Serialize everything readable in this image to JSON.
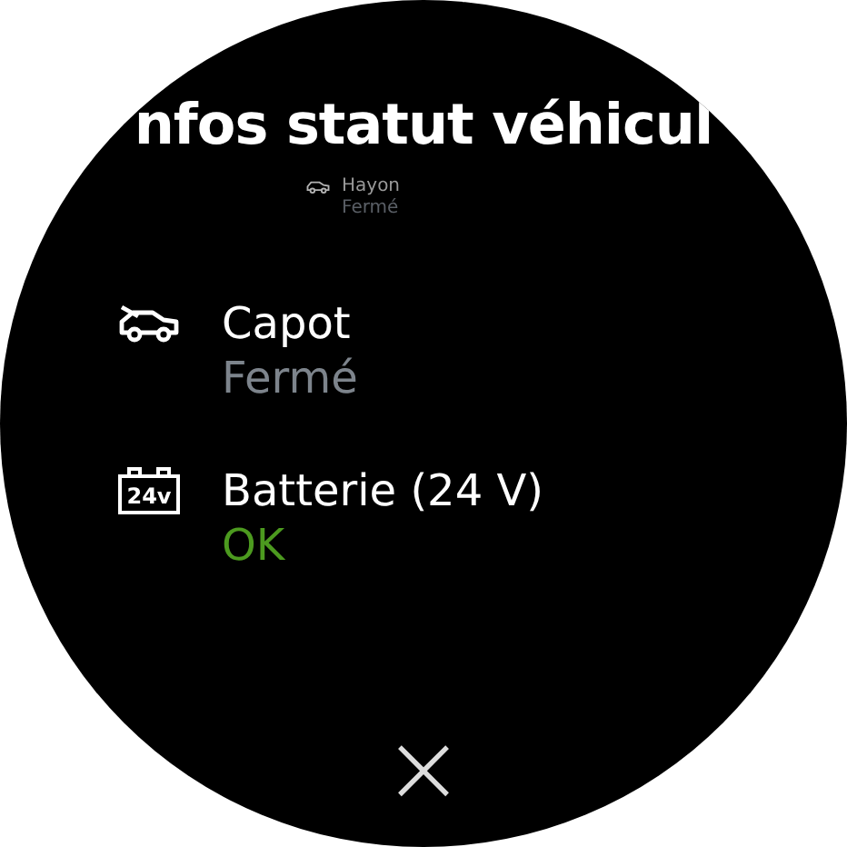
{
  "title": "nfos statut véhicul",
  "items": [
    {
      "kind": "tailgate",
      "label": "Hayon",
      "status": "Fermé",
      "color": "#5a5f66",
      "dimmed": true
    },
    {
      "kind": "hood",
      "label": "Capot",
      "status": "Fermé",
      "color": "#7d848c",
      "dimmed": false
    },
    {
      "kind": "battery",
      "icon_text": "24v",
      "label": "Batterie (24 V)",
      "status": "OK",
      "color": "#4c9a1f",
      "dimmed": false
    }
  ],
  "close_button": "×"
}
